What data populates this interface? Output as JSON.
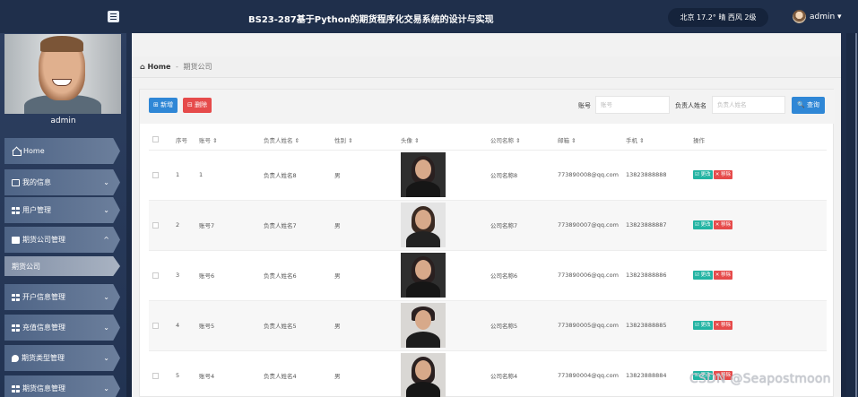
{
  "topbar": {
    "title": "BS23-287基于Python的期货程序化交易系统的设计与实现",
    "weather": "北京 17.2° 晴 西风 2级",
    "user": "admin ▾"
  },
  "sidebar": {
    "username": "admin",
    "items": [
      {
        "label": "Home",
        "icon": "home-icon"
      },
      {
        "label": "我的信息",
        "icon": "card-icon",
        "chevron": "⌄"
      },
      {
        "label": "用户管理",
        "icon": "grid-icon",
        "chevron": "⌄"
      },
      {
        "label": "期货公司管理",
        "icon": "chart-icon",
        "chevron": "^"
      },
      {
        "label": "期货公司",
        "icon": "",
        "chevron": ""
      },
      {
        "label": "开户信息管理",
        "icon": "grid-icon",
        "chevron": "⌄"
      },
      {
        "label": "充值信息管理",
        "icon": "grid-icon",
        "chevron": "⌄"
      },
      {
        "label": "期货类型管理",
        "icon": "pin-icon",
        "chevron": "⌄"
      },
      {
        "label": "期货信息管理",
        "icon": "table-icon",
        "chevron": "⌄"
      }
    ]
  },
  "breadcrumb": {
    "home": "Home",
    "sep": "-",
    "current": "期货公司"
  },
  "toolbar": {
    "add": "⊞ 新增",
    "delete": "⊟ 删除",
    "account_label": "账号",
    "account_placeholder": "账号",
    "manager_label": "负责人姓名",
    "manager_placeholder": "负责人姓名",
    "search": "🔍 查询"
  },
  "table": {
    "headers": [
      "",
      "序号",
      "账号 ⇕",
      "负责人姓名 ⇕",
      "性别 ⇕",
      "头像 ⇕",
      "公司名称 ⇕",
      "邮箱 ⇕",
      "手机 ⇕",
      "操作"
    ],
    "edit_label": "☑ 更改",
    "remove_label": "✕ 移除",
    "rows": [
      {
        "no": "1",
        "account": "1",
        "manager": "负责人姓名8",
        "gender": "男",
        "company": "公司名称8",
        "email": "773890008@qq.com",
        "phone": "13823888888"
      },
      {
        "no": "2",
        "account": "账号7",
        "manager": "负责人姓名7",
        "gender": "男",
        "company": "公司名称7",
        "email": "773890007@qq.com",
        "phone": "13823888887"
      },
      {
        "no": "3",
        "account": "账号6",
        "manager": "负责人姓名6",
        "gender": "男",
        "company": "公司名称6",
        "email": "773890006@qq.com",
        "phone": "13823888886"
      },
      {
        "no": "4",
        "account": "账号5",
        "manager": "负责人姓名5",
        "gender": "男",
        "company": "公司名称5",
        "email": "773890005@qq.com",
        "phone": "13823888885"
      },
      {
        "no": "5",
        "account": "账号4",
        "manager": "负责人姓名4",
        "gender": "男",
        "company": "公司名称4",
        "email": "773890004@qq.com",
        "phone": "13823888884"
      }
    ]
  },
  "watermark": "CSDN @Seapostmoon",
  "colors": {
    "primary": "#2f87d6",
    "danger": "#e64b4b",
    "edit": "#23b4a3",
    "topbar": "#1f2f4b"
  }
}
